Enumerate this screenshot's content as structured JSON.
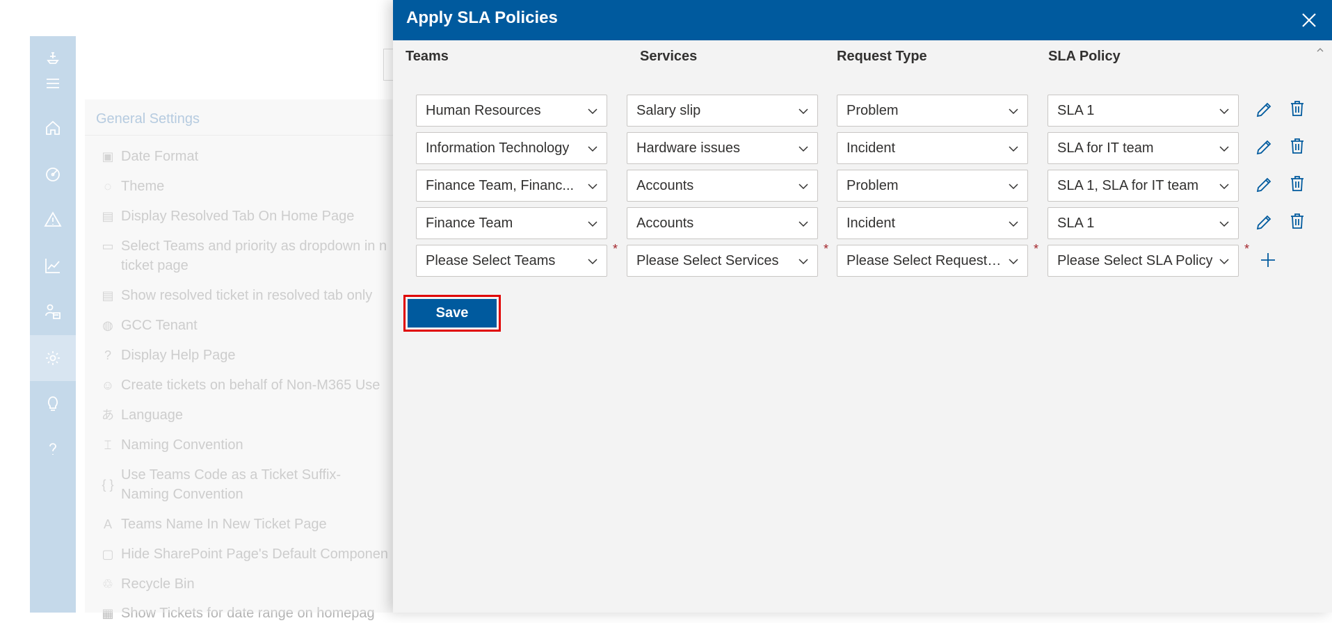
{
  "settings": {
    "title": "General Settings",
    "items": [
      {
        "label": "Date Format",
        "icon": "calendar-clock-icon"
      },
      {
        "label": "Theme",
        "icon": "palette-icon"
      },
      {
        "label": "Display Resolved Tab On Home Page",
        "icon": "document-icon"
      },
      {
        "label": "Select Teams and priority as dropdown in n ticket page",
        "icon": "dropdown-box-icon"
      },
      {
        "label": "Show resolved ticket in resolved tab only",
        "icon": "document-icon"
      },
      {
        "label": "GCC Tenant",
        "icon": "globe-icon"
      },
      {
        "label": "Display Help Page",
        "icon": "question-icon"
      },
      {
        "label": "Create tickets on behalf of Non-M365 Use",
        "icon": "person-remove-icon"
      },
      {
        "label": "Language",
        "icon": "translate-icon"
      },
      {
        "label": "Naming Convention",
        "icon": "rename-icon"
      },
      {
        "label": "Use Teams Code as a Ticket Suffix- Naming Convention",
        "icon": "braces-icon"
      },
      {
        "label": "Teams Name In New Ticket Page",
        "icon": "text-a-icon"
      },
      {
        "label": "Hide SharePoint Page's Default Componen",
        "icon": "window-icon"
      },
      {
        "label": "Recycle Bin",
        "icon": "recycle-bin-icon"
      },
      {
        "label": "Show Tickets for date range on homepag",
        "icon": "calendar-icon"
      }
    ]
  },
  "modal": {
    "title": "Apply SLA Policies",
    "columns": {
      "teams": "Teams",
      "services": "Services",
      "request_type": "Request Type",
      "sla_policy": "SLA Policy"
    },
    "rows": [
      {
        "team": "Human Resources",
        "service": "Salary slip",
        "request_type": "Problem",
        "sla": "SLA 1"
      },
      {
        "team": "Information Technology",
        "service": "Hardware issues",
        "request_type": "Incident",
        "sla": "SLA for IT team"
      },
      {
        "team": "Finance Team, Financ...",
        "service": "Accounts",
        "request_type": "Problem",
        "sla": "SLA 1, SLA for IT team"
      },
      {
        "team": "Finance Team",
        "service": "Accounts",
        "request_type": "Incident",
        "sla": "SLA 1"
      }
    ],
    "new_row": {
      "team_placeholder": "Please Select Teams",
      "service_placeholder": "Please Select Services",
      "request_type_placeholder": "Please Select Request ...",
      "sla_placeholder": "Please Select SLA Policy",
      "required_mark": "*"
    },
    "save_label": "Save"
  },
  "colors": {
    "header": "#005a9e",
    "rail": "#a7c5df",
    "required": "#a4262c",
    "highlight": "#e00000"
  }
}
